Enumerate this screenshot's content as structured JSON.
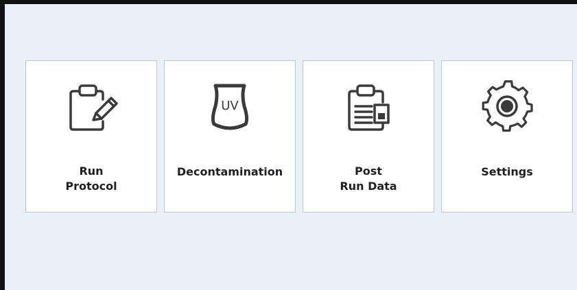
{
  "tiles": [
    {
      "id": "run-protocol",
      "label_lines": [
        "Run",
        "Protocol"
      ],
      "icon": "clipboard-pencil-icon"
    },
    {
      "id": "decontamination",
      "label_lines": [
        "Decontamination"
      ],
      "icon": "uv-lamp-icon",
      "icon_text": "UV"
    },
    {
      "id": "post-run-data",
      "label_lines": [
        "Post",
        "Run Data"
      ],
      "icon": "clipboard-data-icon"
    },
    {
      "id": "settings",
      "label_lines": [
        "Settings"
      ],
      "icon": "gear-icon"
    }
  ],
  "colors": {
    "background": "#eaf0f8",
    "tile": "#ffffff",
    "tile_border": "#b9c6d6",
    "icon": "#3a3a3a",
    "text": "#1f1f1f"
  }
}
